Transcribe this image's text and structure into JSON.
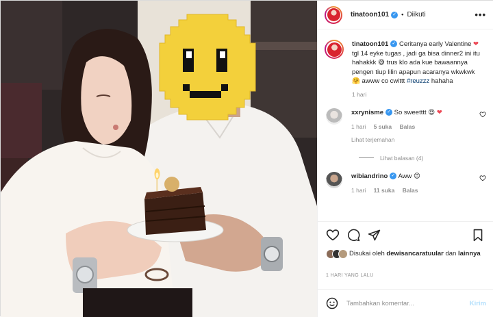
{
  "post": {
    "username": "tinatoon101",
    "follow_status": "Diikuti",
    "more_label": "•••",
    "caption_text": "Ceritanya early Valentine",
    "caption_text_2": "tgl 14 eyke tugas , jadi ga bisa dinner2 ini itu hahakkk",
    "caption_text_3": "trus klo ada kue bawaannya pengen tiup lilin apapun acaranya wkwkwk",
    "caption_text_4": "awww co cwittt",
    "caption_hashtag": "#reuzzz",
    "caption_text_5": "hahaha",
    "caption_time": "1 hari",
    "liked_by_label": "Disukai oleh",
    "liked_by_user": "dewisancaratuular",
    "liked_by_and": "dan",
    "liked_by_others": "lainnya",
    "post_date": "1 HARI YANG LALU"
  },
  "comments": [
    {
      "username": "xxrynisme",
      "text": "So sweetttt",
      "time": "1 hari",
      "likes": "5 suka",
      "reply": "Balas",
      "see_translation": "Lihat terjemahan",
      "view_replies": "Lihat balasan (4)"
    },
    {
      "username": "wibiandrino",
      "text": "Aww",
      "time": "1 hari",
      "likes": "11 suka",
      "reply": "Balas"
    }
  ],
  "comment_box": {
    "placeholder": "Tambahkan komentar...",
    "post_label": "Kirim"
  },
  "icons": [
    "verified-badge-icon",
    "more-options-icon",
    "heart-icon",
    "comment-icon",
    "share-icon",
    "bookmark-icon",
    "emoji-icon"
  ],
  "colors": {
    "verified": "#3897f0",
    "heart": "#ed4956",
    "link": "#00376b",
    "muted": "#8e8e8e",
    "post_button": "#b2dffc"
  }
}
